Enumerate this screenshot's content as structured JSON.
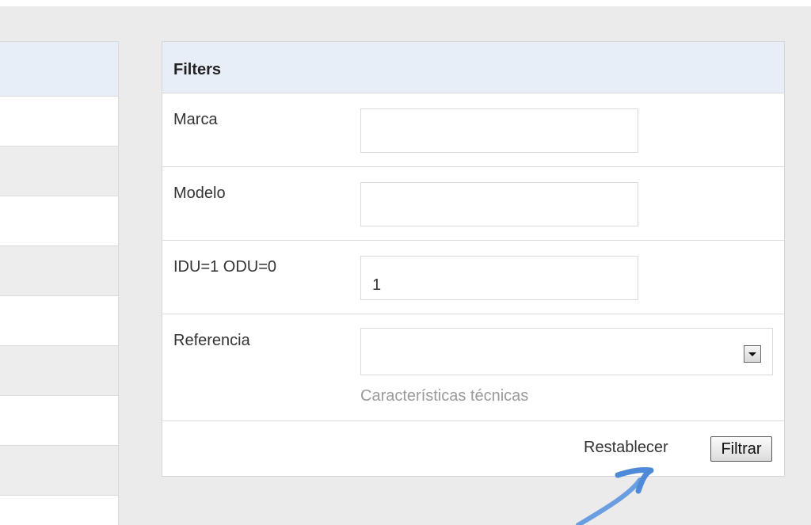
{
  "filters": {
    "title": "Filters",
    "marca": {
      "label": "Marca",
      "value": ""
    },
    "modelo": {
      "label": "Modelo",
      "value": ""
    },
    "idu": {
      "label": "IDU=1 ODU=0",
      "value": "1"
    },
    "referencia": {
      "label": "Referencia",
      "selected": "",
      "help_text": "Características técnicas",
      "dropdown_icon": "chevron-down-icon"
    },
    "actions": {
      "reset_label": "Restablecer",
      "submit_label": "Filtrar"
    }
  },
  "colors": {
    "header_bg": "#e7eef7",
    "page_bg": "#ebebeb",
    "row_alt": "#ededed",
    "annotation_arrow": "#6a9ee0"
  }
}
